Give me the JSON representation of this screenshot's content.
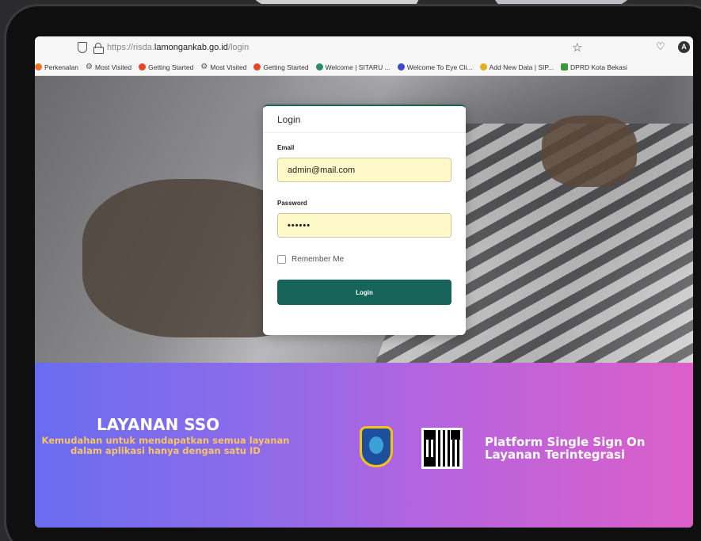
{
  "browser": {
    "url_prefix": "https://risda.",
    "url_domain": "lamongankab.go.id",
    "url_path": "/login",
    "account_initial": "A"
  },
  "bookmarks": [
    {
      "label": "Perkenalan",
      "icon": "firefox-icon"
    },
    {
      "label": "Most Visited",
      "icon": "gear-icon"
    },
    {
      "label": "Getting Started",
      "icon": "firefox-icon"
    },
    {
      "label": "Most Visited",
      "icon": "gear-icon"
    },
    {
      "label": "Getting Started",
      "icon": "firefox-icon"
    },
    {
      "label": "Welcome | SITARU ...",
      "icon": "globe-icon"
    },
    {
      "label": "Welcome To Eye Cli...",
      "icon": "globe-icon"
    },
    {
      "label": "Add New Data | SIP...",
      "icon": "site-icon"
    },
    {
      "label": "DPRD Kota Bekasi",
      "icon": "site-icon"
    }
  ],
  "login": {
    "title": "Login",
    "email_label": "Email",
    "email_value": "admin@mail.com",
    "password_label": "Password",
    "password_value": "••••••",
    "remember_label": "Remember Me",
    "button_label": "Login"
  },
  "banner": {
    "title": "LAYANAN SSO",
    "subtitle_line1": "Kemudahan untuk mendapatkan semua layanan",
    "subtitle_line2": "dalam aplikasi hanya dengan satu ID",
    "platform_line1": "Platform Single Sign On",
    "platform_line2": "Layanan Terintegrasi"
  },
  "colors": {
    "button": "#17645a",
    "autofill": "#fdf9c8",
    "banner_start": "#6a6cf0",
    "banner_end": "#dc5fc9",
    "subtitle": "#f5c46a"
  }
}
